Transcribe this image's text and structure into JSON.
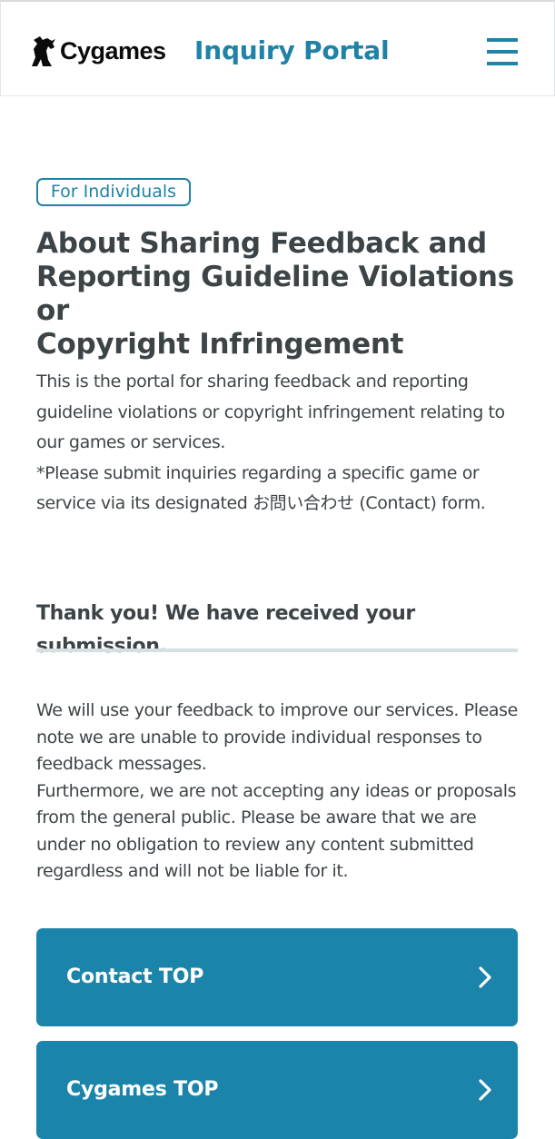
{
  "header": {
    "logo_text": "Cygames",
    "portal_title": "Inquiry Portal",
    "menu_icon": "hamburger-menu-icon"
  },
  "main": {
    "badge": "For Individuals",
    "title_lines": [
      "About Sharing Feedback and",
      "Reporting Guideline Violations or",
      "Copyright Infringement"
    ],
    "intro_lines": [
      "This is the portal for sharing feedback and reporting",
      "guideline violations or copyright infringement relating to",
      "our games or services.",
      "*Please submit inquiries regarding a specific game or",
      "service via its designated お問い合わせ (Contact) form."
    ],
    "thanks_heading": "Thank you! We have received your submission.",
    "body_lines": [
      "We will use your feedback to improve our services. Please",
      "note we are unable to provide individual responses to",
      "feedback messages.",
      "Furthermore, we are not accepting any ideas or proposals",
      "from the general public. Please be aware that we are",
      "under no obligation to review any content submitted",
      "regardless and will not be liable for it."
    ],
    "buttons": [
      {
        "label": "Contact TOP",
        "icon": "chevron-right-icon"
      },
      {
        "label": "Cygames TOP",
        "icon": "chevron-right-icon"
      }
    ]
  },
  "colors": {
    "accent": "#1f82a6",
    "button_bg": "#1b84ab",
    "text": "#3d4448",
    "divider": "#d6e0e3"
  }
}
